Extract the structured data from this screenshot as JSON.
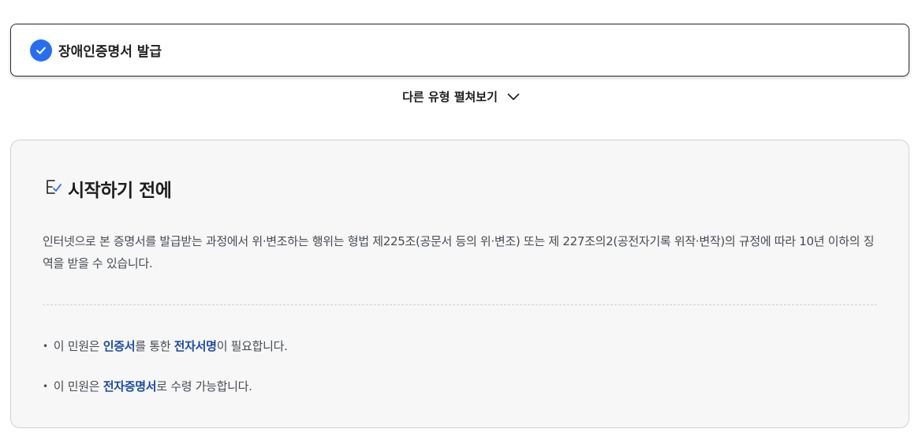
{
  "selected_type": {
    "label": "장애인증명서 발급",
    "icon": "check-circle-icon",
    "accent_color": "#256ef4"
  },
  "expand_toggle": {
    "label": "다른 유형 펼쳐보기",
    "icon": "chevron-down-icon"
  },
  "info_panel": {
    "heading": "시작하기 전에",
    "heading_icon": "checklist-icon",
    "warning": "인터넷으로 본 증명서를 발급받는 과정에서 위·변조하는 행위는 형법 제225조(공문서 등의 위·변조) 또는 제 227조의2(공전자기록 위작·변작)의 규정에 따라 10년 이하의 징역을 받을 수 있습니다.",
    "requirements": [
      {
        "bullet": "•",
        "pre": "이 민원은 ",
        "emph1": "인증서",
        "mid": "를 통한 ",
        "emph2": "전자서명",
        "post": "이 필요합니다."
      },
      {
        "bullet": "•",
        "pre": "이 민원은 ",
        "emph1": "전자증명서",
        "post": "로 수령 가능합니다."
      }
    ],
    "emphasis_color": "#1a4aa5"
  }
}
